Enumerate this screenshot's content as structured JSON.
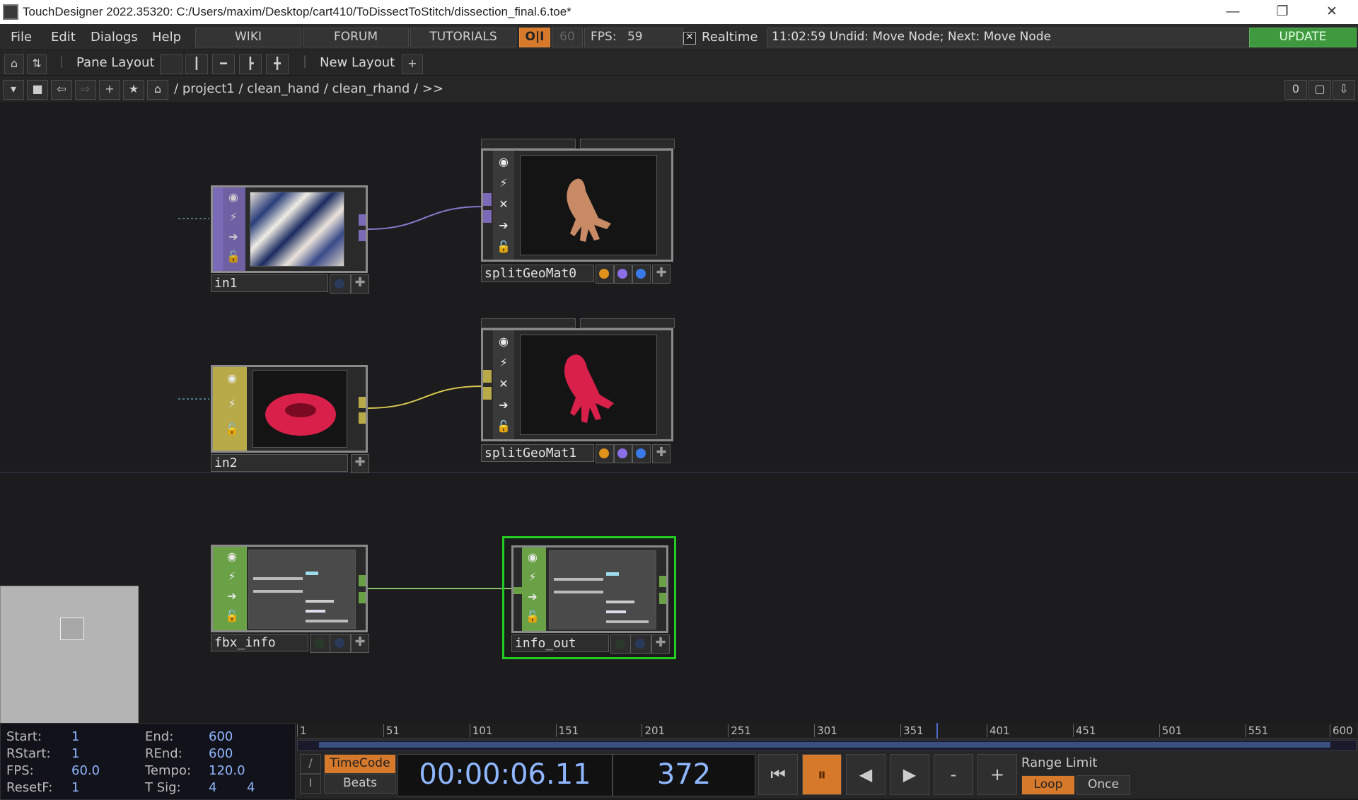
{
  "window": {
    "title": "TouchDesigner 2022.35320: C:/Users/maxim/Desktop/cart410/ToDissectToStitch/dissection_final.6.toe*",
    "minimize": "—",
    "restore": "❐",
    "close": "✕"
  },
  "menu": {
    "items": [
      "File",
      "Edit",
      "Dialogs",
      "Help"
    ],
    "links": [
      "WIKI",
      "FORUM",
      "TUTORIALS"
    ],
    "oi": "O|I",
    "fps_cap": "60",
    "fps_label": "FPS:",
    "fps_value": "59",
    "realtime_check": "✕",
    "realtime": "Realtime",
    "status": "11:02:59 Undid: Move Node; Next: Move Node",
    "update": "UPDATE"
  },
  "pane": {
    "label": "Pane Layout",
    "new_layout": "New Layout",
    "add": "+"
  },
  "path": {
    "crumbs": [
      "/",
      "project1",
      "/",
      "clean_hand",
      "/",
      "clean_rhand",
      "/",
      ">>"
    ],
    "count": "0"
  },
  "nodes": {
    "in1": "in1",
    "in2": "in2",
    "split0": "splitGeoMat0",
    "split1": "splitGeoMat1",
    "fbx": "fbx_info",
    "info_out": "info_out"
  },
  "colors": {
    "top": "#7a6ab8",
    "sop": "#b8aa48",
    "dat": "#6aa046",
    "selected": "#22cc22",
    "orange_dot": "#e0921a",
    "purple_dot": "#8c6fe6",
    "blue_dot": "#3a7ae8"
  },
  "timeline": {
    "start_lbl": "Start:",
    "start": "1",
    "rstart_lbl": "RStart:",
    "rstart": "1",
    "fps_lbl": "FPS:",
    "fps": "60.0",
    "resetf_lbl": "ResetF:",
    "resetf": "1",
    "end_lbl": "End:",
    "end": "600",
    "rend_lbl": "REnd:",
    "rend": "600",
    "tempo_lbl": "Tempo:",
    "tempo": "120.0",
    "tsig_lbl": "T Sig:",
    "tsig_a": "4",
    "tsig_b": "4",
    "ruler": [
      "1",
      "51",
      "101",
      "151",
      "201",
      "251",
      "301",
      "351",
      "401",
      "451",
      "501",
      "551",
      "600"
    ],
    "playhead_frame": 372,
    "timecode_btn": "TimeCode",
    "beats_btn": "Beats",
    "slash": "/",
    "ibar": "I",
    "timecode": "00:00:06.11",
    "frame": "372",
    "range_limit": "Range Limit",
    "loop": "Loop",
    "once": "Once",
    "minus": "-",
    "plus": "+"
  }
}
